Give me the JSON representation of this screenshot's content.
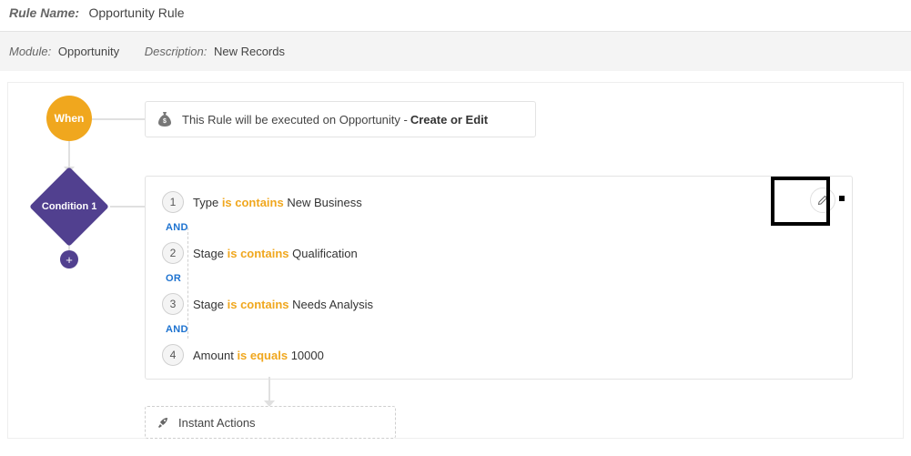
{
  "header": {
    "rule_name_label": "Rule Name:",
    "rule_name_value": "Opportunity Rule"
  },
  "subheader": {
    "module_label": "Module:",
    "module_value": "Opportunity",
    "description_label": "Description:",
    "description_value": "New Records"
  },
  "when": {
    "badge": "When",
    "text_prefix": "This Rule will be executed on Opportunity -",
    "text_bold": "Create or Edit"
  },
  "condition": {
    "badge": "Condition 1",
    "rows": [
      {
        "n": "1",
        "field": "Type",
        "op": "is contains",
        "value": "New Business"
      },
      {
        "n": "2",
        "field": "Stage",
        "op": "is contains",
        "value": "Qualification"
      },
      {
        "n": "3",
        "field": "Stage",
        "op": "is contains",
        "value": "Needs Analysis"
      },
      {
        "n": "4",
        "field": "Amount",
        "op": "is equals",
        "value": "10000"
      }
    ],
    "joins": [
      "AND",
      "OR",
      "AND"
    ]
  },
  "instant_actions": {
    "label": "Instant Actions"
  },
  "add_button": {
    "glyph": "+"
  }
}
